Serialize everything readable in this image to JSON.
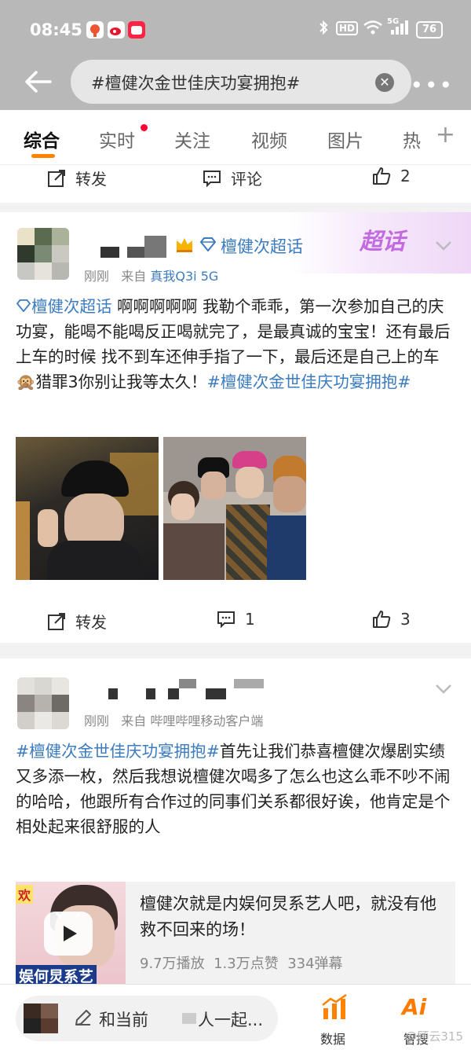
{
  "status_bar": {
    "time": "08:45",
    "battery": "76",
    "network": "HD",
    "signal": "5G"
  },
  "search": {
    "query": "#檀健次金世佳庆功宴拥抱#"
  },
  "tabs": [
    {
      "label": "综合",
      "active": true
    },
    {
      "label": "实时",
      "dot": true
    },
    {
      "label": "关注"
    },
    {
      "label": "视频"
    },
    {
      "label": "图片"
    },
    {
      "label": "热"
    }
  ],
  "post0": {
    "repost": "转发",
    "comment": "评论",
    "likes": "2"
  },
  "post1": {
    "chaohua_tag": "檀健次超话",
    "chaohua_badge": "超话",
    "time": "刚刚",
    "from": "来自",
    "device": "真我Q3i 5G",
    "text_tag": "檀健次超话",
    "text": " 啊啊啊啊啊 我勒个乖乖，第一次参加自己的庆功宴，能喝不能喝反正喝就完了，是最真诚的宝宝！还有最后上车的时候 找不到车还伸手指了一下，最后还是自己上的车🙊猎罪3你别让我等太久！",
    "hashtag": "#檀健次金世佳庆功宴拥抱#",
    "repost": "转发",
    "comments": "1",
    "likes": "3"
  },
  "post2": {
    "time": "刚刚",
    "from": "来自",
    "source": "哔哩哔哩移动客户端",
    "hashtag": "#檀健次金世佳庆功宴拥抱#",
    "text": "首先让我们恭喜檀健次爆剧实绩又多添一枚，然后我想说檀健次喝多了怎么也这么乖不吵不闹的哈哈，他跟所有合作过的同事们关系都很好诶，他肯定是个相处起来很舒服的人",
    "video": {
      "title": "檀健次就是内娱何炅系艺人吧，就没有他救不回来的场！",
      "plays": "9.7万播放",
      "likes": "1.3万点赞",
      "danmaku": "334弹幕",
      "thumb_top": "欢",
      "thumb_bottom": "娱何炅系艺"
    }
  },
  "bottom_bar": {
    "comment_prefix": "和当前",
    "comment_suffix": "人一起...",
    "data_label": "数据",
    "ai_label": "智搜",
    "ai_icon": "Ai"
  },
  "watermark": "@顾云315",
  "colors": {
    "accent": "#ff8200",
    "link": "#3b7bbf",
    "badge": "#c26be0"
  }
}
